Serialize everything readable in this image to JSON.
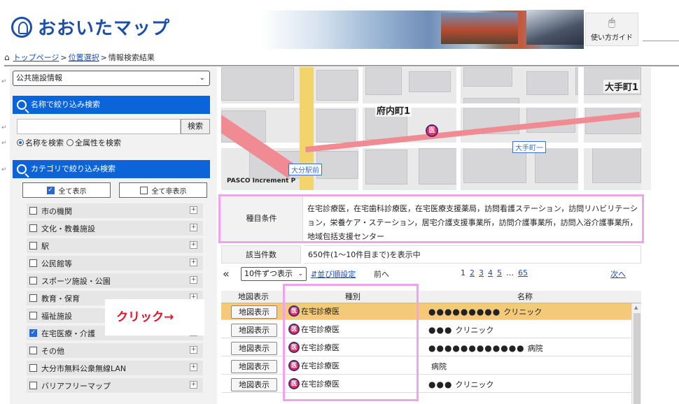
{
  "header": {
    "logo_text": "おおいたマップ",
    "guide_label": "使い方ガイド",
    "guide_icon": "mouse-icon"
  },
  "breadcrumb": {
    "home_icon": "home-icon",
    "items": [
      "トップページ",
      "位置選択",
      "情報検索結果"
    ],
    "separator": ">"
  },
  "sidebar": {
    "select_value": "公共施設情報",
    "name_search": {
      "title": "名称で絞り込み検索",
      "input_value": "",
      "button": "検索",
      "radio_name": "名称を検索",
      "radio_all": "全属性を検索"
    },
    "category_search": {
      "title": "カテゴリで絞り込み検索",
      "show_all": "全て表示",
      "hide_all": "全て非表示",
      "items": [
        {
          "label": "市の機関",
          "checked": false
        },
        {
          "label": "文化・教養施設",
          "checked": false
        },
        {
          "label": "駅",
          "checked": false
        },
        {
          "label": "公民館等",
          "checked": false
        },
        {
          "label": "スポーツ施設・公園",
          "checked": false
        },
        {
          "label": "教育・保育",
          "checked": false
        },
        {
          "label": "福祉施設",
          "checked": false
        },
        {
          "label": "在宅医療・介護",
          "checked": true
        },
        {
          "label": "その他",
          "checked": false
        },
        {
          "label": "大分市無料公衆無線LAN",
          "checked": false
        },
        {
          "label": "バリアフリーマップ",
          "checked": false
        }
      ]
    },
    "callout": "クリック→"
  },
  "map": {
    "labels": [
      "府内町1",
      "大手町1",
      "大手町一",
      "大分駅前"
    ],
    "credit": "PASCO Increment P",
    "marker_glyph": "医"
  },
  "conditions": {
    "label": "種目条件",
    "text": "在宅診療医，在宅歯科診療医，在宅医療支援薬局，訪問看護ステーション，訪問リハビリテーション，栄養ケア・ステーション，居宅介護支援事業所，訪問介護事業所，訪問入浴介護事業所，地域包括支援センター"
  },
  "hits": {
    "label": "該当件数",
    "text": "650件(1〜10件目まで)を表示中"
  },
  "pager": {
    "first_icon": "«",
    "per_page": "10件ずつ表示",
    "sort_link": "並び順設定",
    "prev": "前へ",
    "pages": [
      "1",
      "2",
      "3",
      "4",
      "5",
      "…",
      "65"
    ],
    "next": "次へ"
  },
  "table": {
    "headers": [
      "地図表示",
      "種別",
      "名称"
    ],
    "map_button": "地図表示",
    "rows": [
      {
        "kind": "在宅診療医",
        "name_dots": "●●●●●●●●●",
        "name_suffix": "クリニック",
        "selected": true
      },
      {
        "kind": "在宅診療医",
        "name_dots": "●●●",
        "name_suffix": "クリニック",
        "selected": false
      },
      {
        "kind": "在宅診療医",
        "name_dots": "●●●●●●●●●●●●",
        "name_suffix": "病院",
        "selected": false
      },
      {
        "kind": "在宅診療医",
        "name_dots": "",
        "name_suffix": "病院",
        "selected": false
      },
      {
        "kind": "在宅診療医",
        "name_dots": "●●●",
        "name_suffix": "クリニック",
        "selected": false
      }
    ]
  },
  "colors": {
    "brand_blue": "#1d4fa8",
    "panel_blue": "#0b64d8",
    "highlight_pink": "#f2a3ee",
    "selected_row": "#f5c97a",
    "callout_red": "#e0102a",
    "medical_marker": "#e8326b"
  }
}
